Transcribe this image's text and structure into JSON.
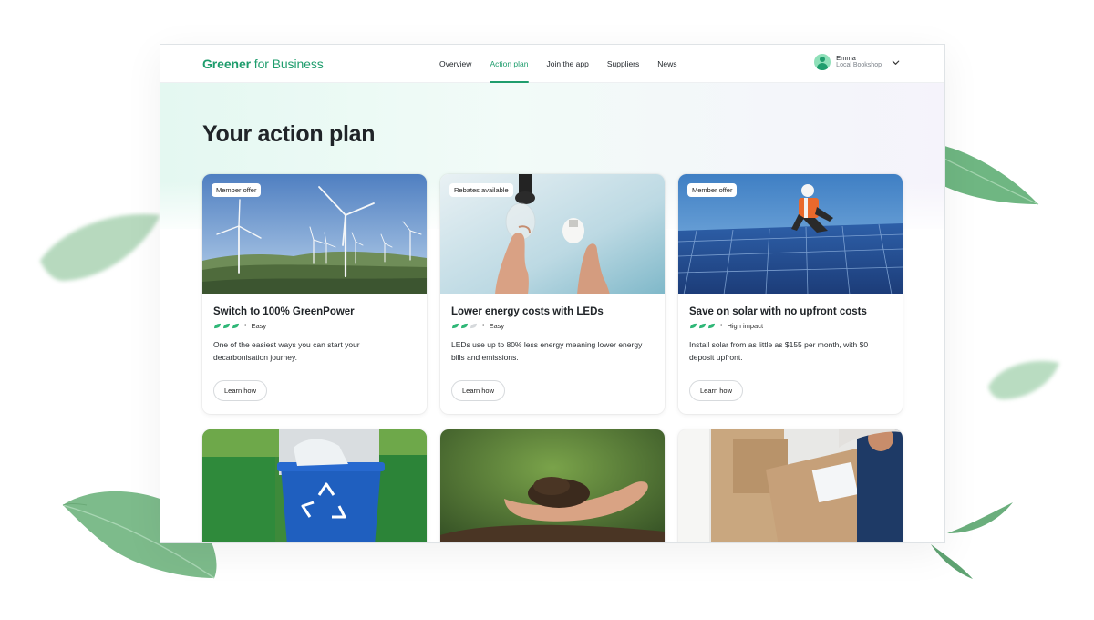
{
  "header": {
    "brand_bold": "Greener",
    "brand_rest": " for Business",
    "nav": [
      {
        "label": "Overview",
        "active": false
      },
      {
        "label": "Action plan",
        "active": true
      },
      {
        "label": "Join the app",
        "active": false
      },
      {
        "label": "Suppliers",
        "active": false
      },
      {
        "label": "News",
        "active": false
      }
    ],
    "user": {
      "name": "Emma",
      "org": "Local Bookshop"
    }
  },
  "page": {
    "title": "Your action plan"
  },
  "cards": [
    {
      "badge": "Member offer",
      "title": "Switch to 100% GreenPower",
      "rating": 3,
      "rating_max": 3,
      "meta": "Easy",
      "description": "One of the easiest ways you can start your decarbonisation journey.",
      "button": "Learn how",
      "image": "wind-turbines"
    },
    {
      "badge": "Rebates available",
      "title": "Lower energy costs with LEDs",
      "rating": 2,
      "rating_max": 3,
      "meta": "Easy",
      "description": "LEDs use up to 80% less energy meaning lower energy bills and emissions.",
      "button": "Learn how",
      "image": "led-bulbs"
    },
    {
      "badge": "Member offer",
      "title": "Save on solar with no upfront costs",
      "rating": 3,
      "rating_max": 3,
      "meta": "High impact",
      "description": "Install solar from as little as $155 per month, with $0 deposit upfront.",
      "button": "Learn how",
      "image": "solar-panels"
    },
    {
      "image": "recycling-bin"
    },
    {
      "image": "soil-in-hand"
    },
    {
      "image": "delivery-box"
    }
  ],
  "colors": {
    "brand": "#1f9d6d",
    "rating_on": "#2fb777",
    "rating_off": "#d6d9dc"
  }
}
